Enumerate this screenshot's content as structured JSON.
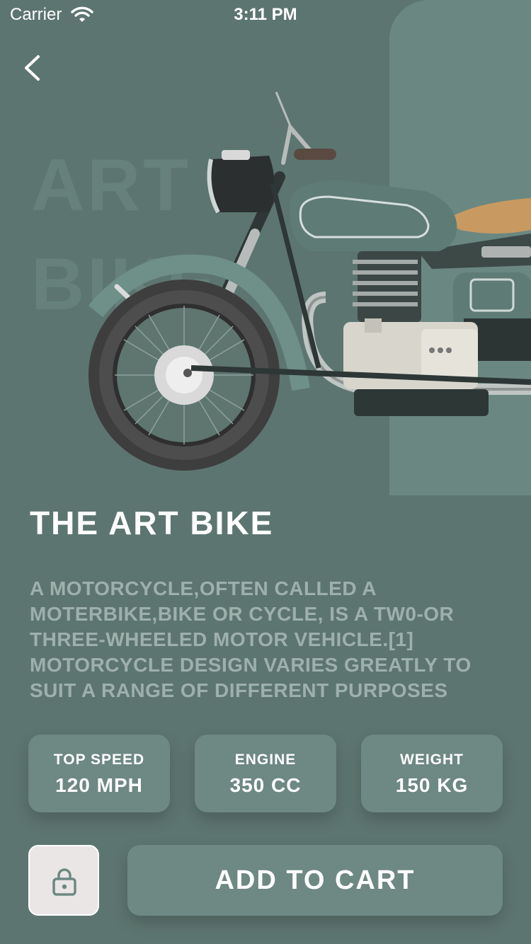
{
  "status_bar": {
    "carrier": "Carrier",
    "time": "3:11 PM"
  },
  "background_text": {
    "line1": "ART",
    "line2": "BIKE"
  },
  "product": {
    "title": "THE ART BIKE",
    "description": "A MOTORCYCLE,OFTEN CALLED A MOTERBIKE,BIKE OR CYCLE, IS A TW0-OR THREE-WHEELED MOTOR VEHICLE.[1] MOTORCYCLE DESIGN VARIES GREATLY TO SUIT A RANGE OF DIFFERENT PURPOSES"
  },
  "specs": [
    {
      "label": "TOP SPEED",
      "value": "120 MPH"
    },
    {
      "label": "ENGINE",
      "value": "350 CC"
    },
    {
      "label": "WEIGHT",
      "value": "150 KG"
    }
  ],
  "actions": {
    "add_to_cart": "ADD TO CART"
  },
  "icons": {
    "back": "chevron-left-icon",
    "lock": "lock-icon",
    "wifi": "wifi-icon",
    "battery": "battery-icon"
  },
  "colors": {
    "background": "#5d7570",
    "panel": "#6b8782",
    "card": "#6e8883",
    "lock_button": "#eae6e5",
    "description_text": "#9eb0ac"
  }
}
